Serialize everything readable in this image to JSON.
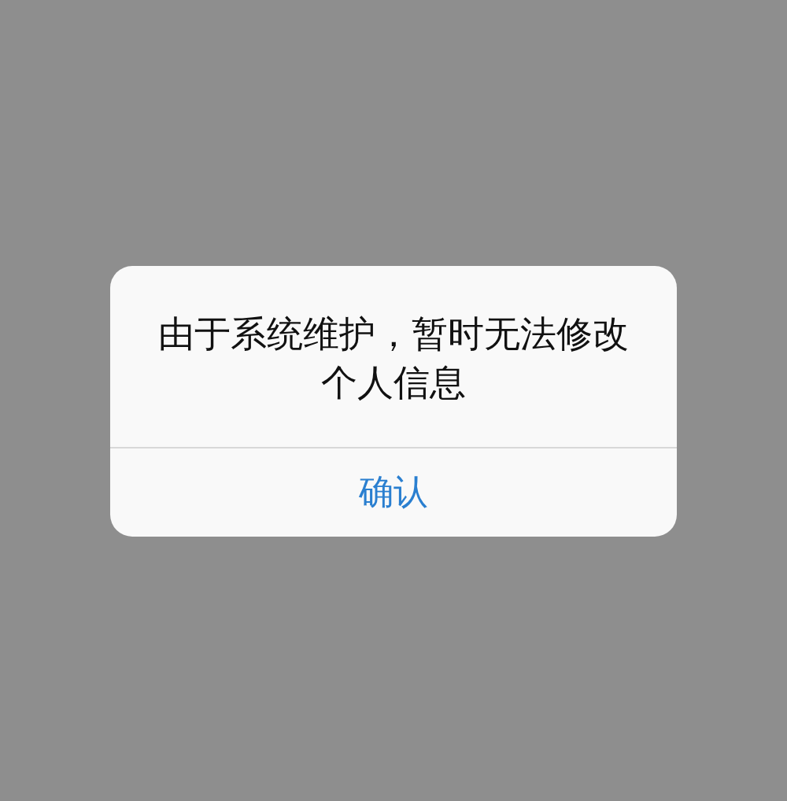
{
  "alert": {
    "message": "由于系统维护，暂时无法修改个人信息",
    "buttons": [
      {
        "label": "确认"
      }
    ]
  }
}
